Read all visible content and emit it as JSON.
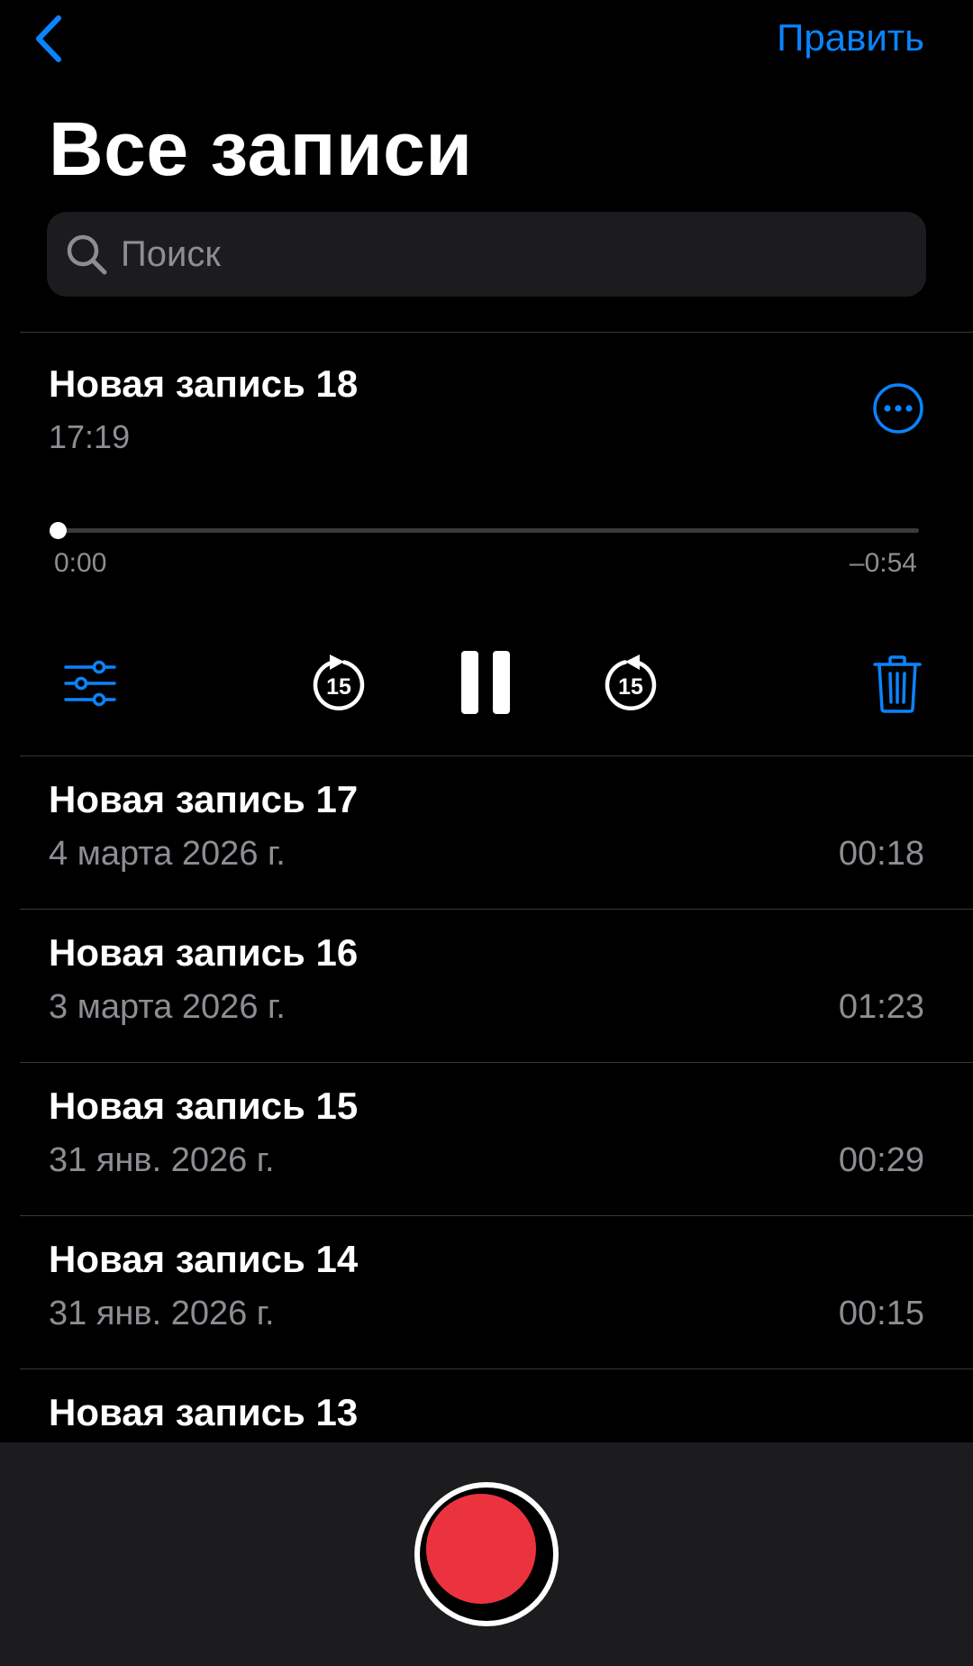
{
  "nav": {
    "back_icon": "chevron-left-icon",
    "edit_label": "Править"
  },
  "title": "Все записи",
  "search": {
    "placeholder": "Поиск",
    "value": ""
  },
  "player": {
    "title": "Новая запись 18",
    "time": "17:19",
    "elapsed": "0:00",
    "remaining": "–0:54",
    "progress": 0.0,
    "icons": {
      "more": "ellipsis-circle-icon",
      "settings": "sliders-icon",
      "skip_back": "skip-back-15-icon",
      "pause": "pause-icon",
      "skip_forward": "skip-forward-15-icon",
      "trash": "trash-icon"
    },
    "skip_seconds": "15"
  },
  "recordings": [
    {
      "title": "Новая запись 17",
      "date": "4 марта 2026 г.",
      "duration": "00:18"
    },
    {
      "title": "Новая запись 16",
      "date": "3 марта 2026 г.",
      "duration": "01:23"
    },
    {
      "title": "Новая запись 15",
      "date": "31 янв. 2026 г.",
      "duration": "00:29"
    },
    {
      "title": "Новая запись 14",
      "date": "31 янв. 2026 г.",
      "duration": "00:15"
    },
    {
      "title": "Новая запись 13",
      "date": "",
      "duration": ""
    }
  ],
  "colors": {
    "accent": "#0a84ff",
    "background": "#000000",
    "secondary_text": "#8d8d93",
    "record": "#eb3340",
    "bar": "#1c1c1e"
  },
  "record_button_icon": "record-icon"
}
